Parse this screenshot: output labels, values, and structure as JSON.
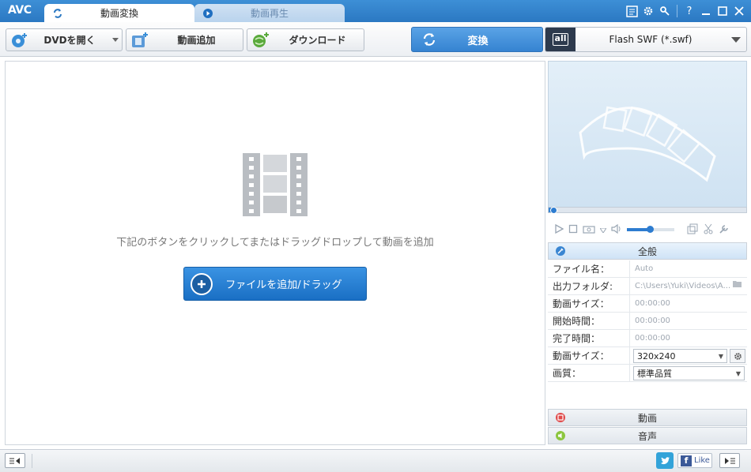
{
  "app": {
    "logo": "AVC"
  },
  "tabs": [
    {
      "label": "動画変換",
      "active": true
    },
    {
      "label": "動画再生",
      "active": false
    }
  ],
  "window_controls": [
    "menu-icon",
    "gear-icon",
    "key-icon",
    "help-icon",
    "minimize-icon",
    "maximize-icon",
    "close-icon"
  ],
  "window_labels": {
    "help": "?"
  },
  "toolbar": {
    "dvd_open": "DVDを開く",
    "add_video": "動画追加",
    "download": "ダウンロード",
    "convert": "変換",
    "format_badge": "all",
    "format": "Flash SWF (*.swf)"
  },
  "main": {
    "hint": "下記のボタンをクリックしてまたはドラッグドロップして動画を追加",
    "add_file_button": "ファイルを追加/ドラッグ"
  },
  "preview": {
    "seek_position": 0.01,
    "volume_level": 0.48
  },
  "sections": {
    "general": "全般",
    "video": "動画",
    "audio": "音声"
  },
  "properties": [
    {
      "name": "ファイル名：",
      "value": "Auto"
    },
    {
      "name": "出力フォルダ:",
      "value": "C:\\Users\\Yuki\\Videos\\A..."
    },
    {
      "name": "動画サイズ：",
      "value": "00:00:00"
    },
    {
      "name": "開始時間：",
      "value": "00:00:00"
    },
    {
      "name": "完了時間：",
      "value": "00:00:00"
    },
    {
      "name": "動画サイズ：",
      "value": "320x240"
    },
    {
      "name": "画質：",
      "value": "標準品質"
    }
  ],
  "status": {
    "like": "Like",
    "facebook_glyph": "f"
  },
  "colors": {
    "title_bar": "#2b78c2",
    "convert_button": "#3583d1",
    "add_button": "#1a6fc4"
  }
}
